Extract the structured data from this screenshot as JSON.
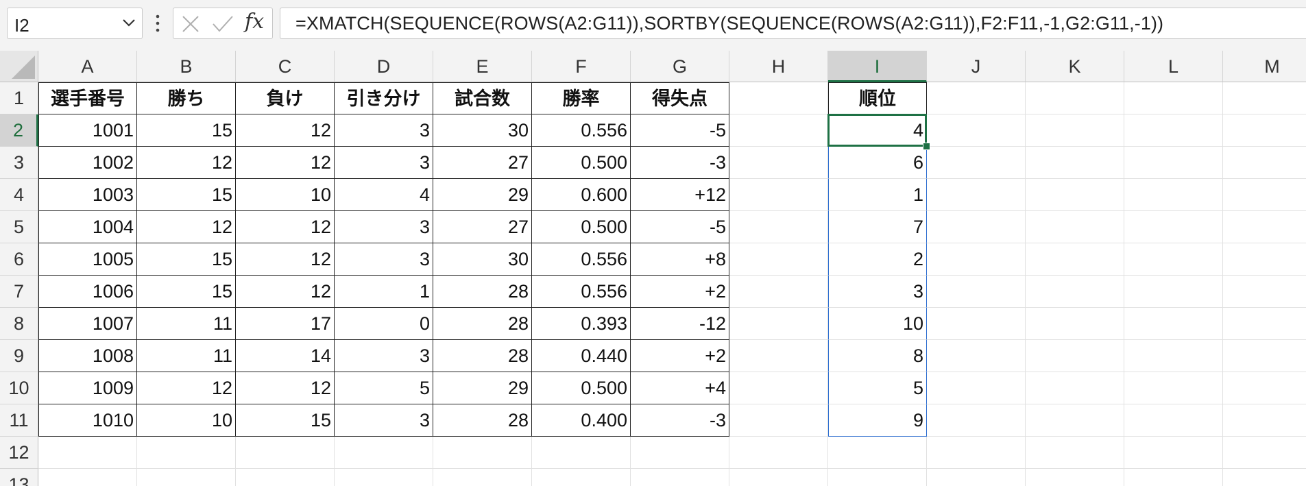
{
  "namebox": {
    "value": "I2"
  },
  "formula": {
    "fx_label": "fx",
    "text": "=XMATCH(SEQUENCE(ROWS(A2:G11)),SORTBY(SEQUENCE(ROWS(A2:G11)),F2:F11,-1,G2:G11,-1))"
  },
  "columns": [
    "A",
    "B",
    "C",
    "D",
    "E",
    "F",
    "G",
    "H",
    "I",
    "J",
    "K",
    "L",
    "M"
  ],
  "rows": [
    "1",
    "2",
    "3",
    "4",
    "5",
    "6",
    "7",
    "8",
    "9",
    "10",
    "11",
    "12",
    "13"
  ],
  "selection": {
    "active_cell": "I2",
    "range": "I2:I11"
  },
  "table": {
    "headers": [
      "選手番号",
      "勝ち",
      "負け",
      "引き分け",
      "試合数",
      "勝率",
      "得失点"
    ],
    "rows": [
      [
        "1001",
        "15",
        "12",
        "3",
        "30",
        "0.556",
        "-5"
      ],
      [
        "1002",
        "12",
        "12",
        "3",
        "27",
        "0.500",
        "-3"
      ],
      [
        "1003",
        "15",
        "10",
        "4",
        "29",
        "0.600",
        "+12"
      ],
      [
        "1004",
        "12",
        "12",
        "3",
        "27",
        "0.500",
        "-5"
      ],
      [
        "1005",
        "15",
        "12",
        "3",
        "30",
        "0.556",
        "+8"
      ],
      [
        "1006",
        "15",
        "12",
        "1",
        "28",
        "0.556",
        "+2"
      ],
      [
        "1007",
        "11",
        "17",
        "0",
        "28",
        "0.393",
        "-12"
      ],
      [
        "1008",
        "11",
        "14",
        "3",
        "28",
        "0.440",
        "+2"
      ],
      [
        "1009",
        "12",
        "12",
        "5",
        "29",
        "0.500",
        "+4"
      ],
      [
        "1010",
        "10",
        "15",
        "3",
        "28",
        "0.400",
        "-3"
      ]
    ]
  },
  "rank": {
    "header": "順位",
    "values": [
      "4",
      "6",
      "1",
      "7",
      "2",
      "3",
      "10",
      "8",
      "5",
      "9"
    ]
  },
  "colors": {
    "accent": "#1e7145",
    "range_border": "#2f6fd0"
  }
}
